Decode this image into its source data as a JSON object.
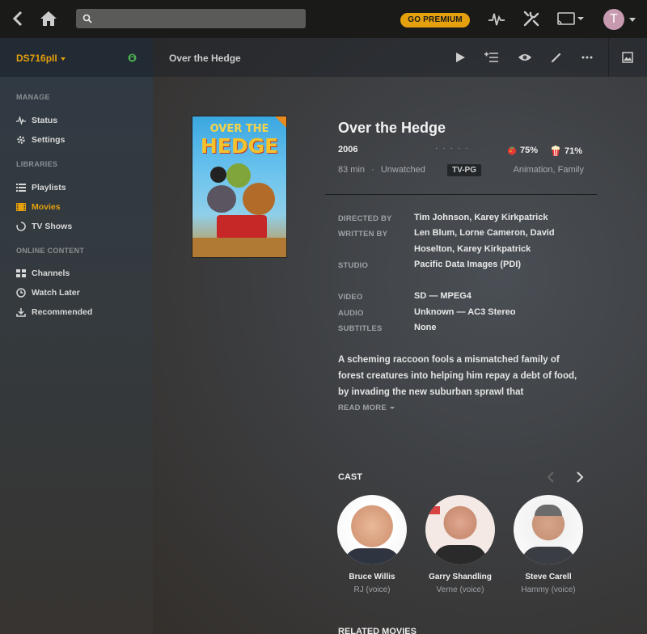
{
  "topbar": {
    "search_placeholder": "",
    "premium_label": "GO PREMIUM",
    "avatar_initial": "T"
  },
  "sidebar": {
    "server_name": "DS716pII",
    "sections": {
      "manage": "MANAGE",
      "libraries": "LIBRARIES",
      "online": "ONLINE CONTENT"
    },
    "manage_items": [
      {
        "label": "Status",
        "icon": "activity-icon"
      },
      {
        "label": "Settings",
        "icon": "gear-icon"
      }
    ],
    "library_items": [
      {
        "label": "Playlists",
        "icon": "list-icon"
      },
      {
        "label": "Movies",
        "icon": "film-icon",
        "active": true
      },
      {
        "label": "TV Shows",
        "icon": "spinner-icon"
      }
    ],
    "online_items": [
      {
        "label": "Channels",
        "icon": "grid-icon"
      },
      {
        "label": "Watch Later",
        "icon": "clock-icon"
      },
      {
        "label": "Recommended",
        "icon": "download-icon"
      }
    ]
  },
  "header": {
    "title": "Over the Hedge"
  },
  "movie": {
    "title": "Over the Hedge",
    "year": "2006",
    "critic_rating": "75%",
    "audience_rating": "71%",
    "duration": "83 min",
    "status": "Unwatched",
    "content_rating": "TV-PG",
    "genres": "Animation, Family",
    "poster_line1": "OVER THE",
    "poster_line2": "HEDGE",
    "details": {
      "directed_by_label": "DIRECTED BY",
      "directed_by": "Tim Johnson, Karey Kirkpatrick",
      "written_by_label": "WRITTEN BY",
      "written_by": "Len Blum, Lorne Cameron, David Hoselton, Karey Kirkpatrick",
      "studio_label": "STUDIO",
      "studio": "Pacific Data Images (PDI)",
      "video_label": "VIDEO",
      "video": "SD — MPEG4",
      "audio_label": "AUDIO",
      "audio": "Unknown — AC3 Stereo",
      "subtitles_label": "SUBTITLES",
      "subtitles": "None"
    },
    "summary": "A scheming raccoon fools a mismatched family of forest creatures into helping him repay a debt of food, by invading the new suburban sprawl that",
    "read_more": "READ MORE"
  },
  "cast": {
    "heading": "CAST",
    "people": [
      {
        "name": "Bruce Willis",
        "role": "RJ (voice)"
      },
      {
        "name": "Garry Shandling",
        "role": "Verne (voice)"
      },
      {
        "name": "Steve Carell",
        "role": "Hammy (voice)"
      }
    ]
  },
  "related_heading": "RELATED MOVIES",
  "colors": {
    "accent": "#e5a00d",
    "topbar": "#1a1a19",
    "status_ok": "#4caf50"
  }
}
